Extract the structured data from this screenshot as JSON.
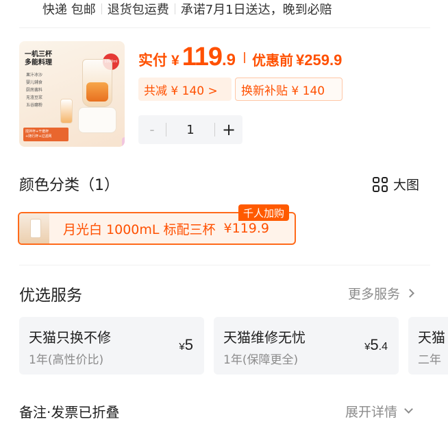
{
  "shipping": {
    "items": [
      "快递 包邮",
      "退货包运费",
      "承诺7月1日送达，晚到必赔"
    ]
  },
  "product": {
    "image_text": {
      "title_line1": "一机三杯",
      "title_line2": "多能料理",
      "features": [
        "果汁冰沙",
        "婴儿辅食",
        "厨房酱料",
        "无渣豆浆",
        "五谷磨粉"
      ],
      "capacity_badge": "1000ml",
      "footer_line1": "搅拌杯+干磨杯",
      "footer_line2": "+随行杯+过滤网"
    },
    "price": {
      "label": "实付",
      "currency": "¥",
      "integer": "119",
      "decimal": ".9",
      "pre_label": "优惠前",
      "pre_value": "¥259.9"
    },
    "tags": {
      "total_discount": "共减 ¥ 140 >",
      "trade_in": "换新补贴 ¥ 140"
    },
    "quantity": {
      "minus": "-",
      "value": "1",
      "plus": "+"
    }
  },
  "color": {
    "title": "颜色分类（1）",
    "big_view_label": "大图",
    "selected_variant": {
      "name": "月光白 1000mL 标配三杯",
      "price": "¥119.9",
      "badge": "千人加购"
    }
  },
  "services": {
    "title": "优选服务",
    "more_label": "更多服务",
    "cards": [
      {
        "name": "天猫只换不修",
        "desc": "1年(高性价比)",
        "currency": "¥",
        "price_int": "5",
        "price_dec": ""
      },
      {
        "name": "天猫维修无忧",
        "desc": "1年(保障更全)",
        "currency": "¥",
        "price_int": "5",
        "price_dec": ".4"
      },
      {
        "name": "天猫",
        "desc": "二年",
        "currency": "",
        "price_int": "",
        "price_dec": ""
      }
    ]
  },
  "notes": {
    "label": "备注·发票已折叠",
    "expand_label": "展开详情"
  }
}
